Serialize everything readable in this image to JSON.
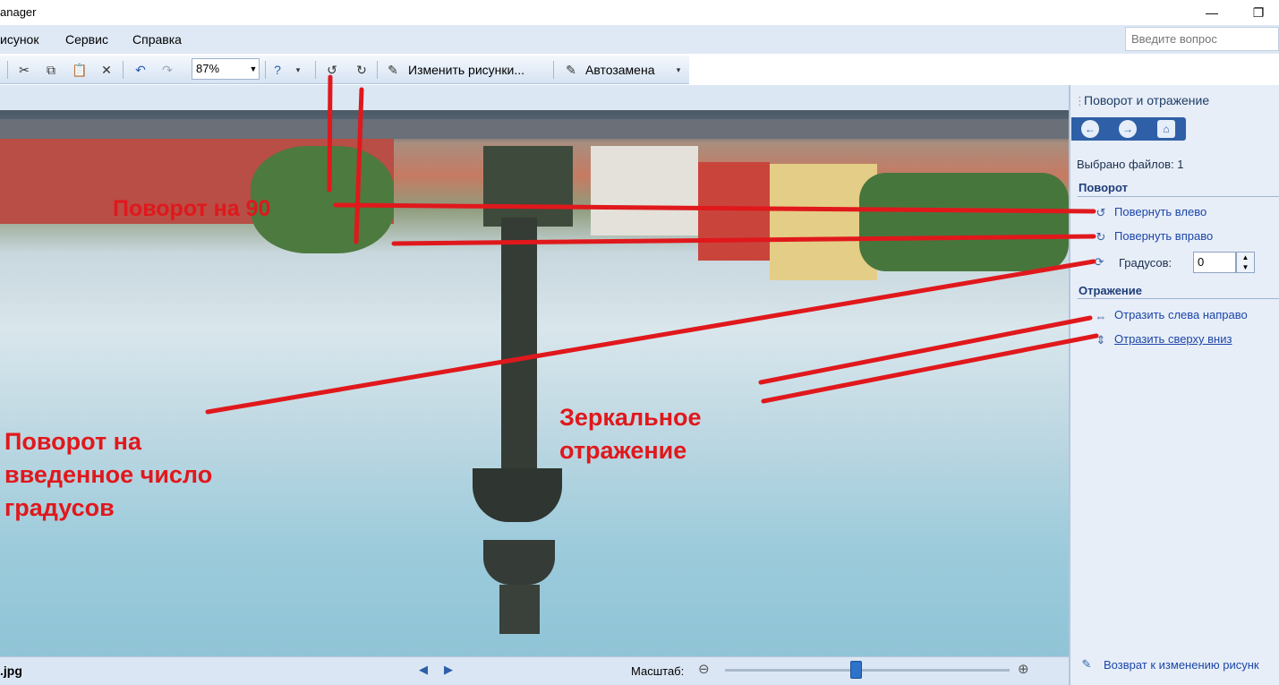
{
  "window": {
    "title": "anager",
    "minimize_glyph": "—",
    "restore_glyph": "❐"
  },
  "menu": {
    "items": [
      "исунок",
      "Сервис",
      "Справка"
    ],
    "help_placeholder": "Введите вопрос"
  },
  "toolbar": {
    "zoom_value": "87%",
    "edit_pictures_label": "Изменить рисунки...",
    "autocorrect_label": "Автозамена"
  },
  "status": {
    "filename": ".jpg",
    "scale_label": "Масштаб:",
    "zoom_level_fraction": 0.46
  },
  "pane": {
    "title": "Поворот и отражение",
    "files_selected": "Выбрано файлов: 1",
    "rotation_header": "Поворот",
    "rotate_left": "Повернуть влево",
    "rotate_right": "Повернуть вправо",
    "degrees_label": "Градусов:",
    "degrees_value": "0",
    "flip_header": "Отражение",
    "flip_horizontal": "Отразить слева направо",
    "flip_vertical": "Отразить сверху вниз",
    "back_link": "Возврат к изменению рисунк"
  },
  "annotations": {
    "rotate90": "Поворот на 90",
    "rotate_degrees": [
      "Поворот на",
      "введенное число",
      "градусов"
    ],
    "mirror": [
      "Зеркальное",
      "отражение"
    ]
  },
  "colors": {
    "annotation_red": "#e0181c",
    "pane_background": "#e7eef8",
    "link_blue": "#1d46a8"
  }
}
